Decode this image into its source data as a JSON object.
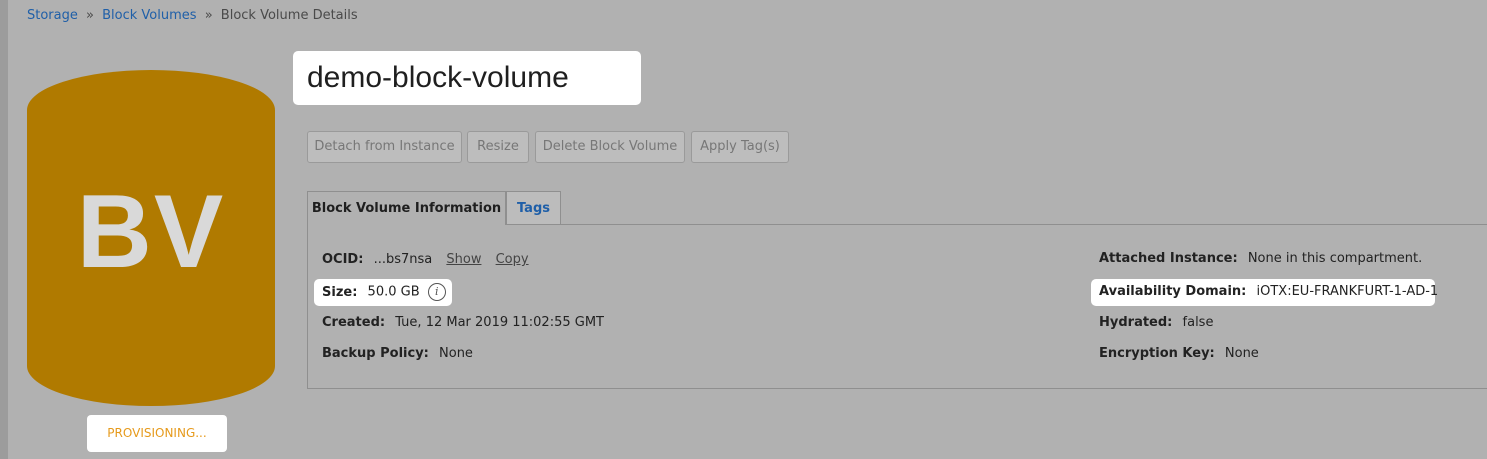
{
  "breadcrumb": {
    "item1": "Storage",
    "sep": "»",
    "item2": "Block Volumes",
    "current": "Block Volume Details"
  },
  "volume": {
    "initials": "BV",
    "status": "PROVISIONING...",
    "name": "demo-block-volume"
  },
  "actions": {
    "detach": "Detach from Instance",
    "resize": "Resize",
    "delete": "Delete Block Volume",
    "apply_tags": "Apply Tag(s)"
  },
  "tabs": {
    "info": "Block Volume Information",
    "tags": "Tags"
  },
  "details": {
    "ocid_label": "OCID:",
    "ocid_value": "...bs7nsa",
    "show": "Show",
    "copy": "Copy",
    "size_label": "Size:",
    "size_value": "50.0 GB",
    "created_label": "Created:",
    "created_value": "Tue, 12 Mar 2019 11:02:55 GMT",
    "backup_label": "Backup Policy:",
    "backup_value": "None",
    "attached_label": "Attached Instance:",
    "attached_value": "None in this compartment.",
    "ad_label": "Availability Domain:",
    "ad_value": "iOTX:EU-FRANKFURT-1-AD-1",
    "hydrated_label": "Hydrated:",
    "hydrated_value": "false",
    "encryption_label": "Encryption Key:",
    "encryption_value": "None"
  },
  "colors": {
    "background": "#b1b1b1",
    "volume_icon": "#b07a00",
    "status_text": "#e69a1c",
    "link": "#1f5fa8"
  }
}
